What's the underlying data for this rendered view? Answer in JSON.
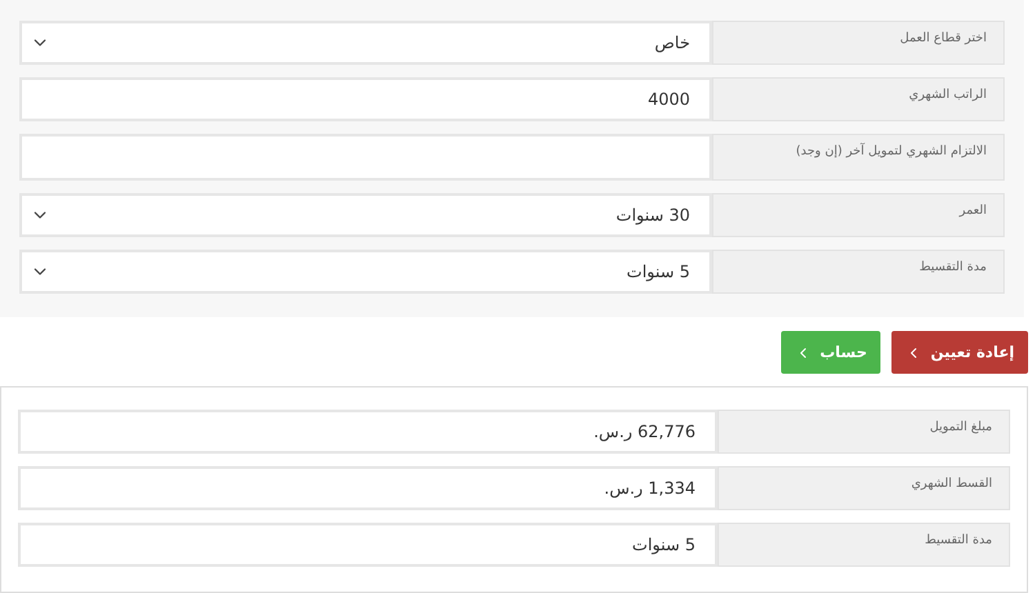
{
  "form": {
    "fields": [
      {
        "label": "اختر قطاع العمل",
        "kind": "select",
        "value": "خاص"
      },
      {
        "label": "الراتب الشهري",
        "kind": "text",
        "value": "4000"
      },
      {
        "label": "الالتزام الشهري لتمويل آخر (إن وجد)",
        "kind": "text"
      },
      {
        "label": "العمر",
        "kind": "select",
        "value": "30 سنوات"
      },
      {
        "label": "مدة التقسيط",
        "kind": "select",
        "value": "5 سنوات"
      }
    ]
  },
  "buttons": [
    {
      "label": "إعادة تعيين",
      "kind": "reset"
    },
    {
      "label": "حساب",
      "kind": "calculate"
    }
  ],
  "results": [
    {
      "label": "مبلغ التمويل",
      "value": "62,776 ر.س."
    },
    {
      "label": "القسط الشهري",
      "value": "1,334 ر.س."
    },
    {
      "label": "مدة التقسيط",
      "value": "5 سنوات"
    }
  ]
}
